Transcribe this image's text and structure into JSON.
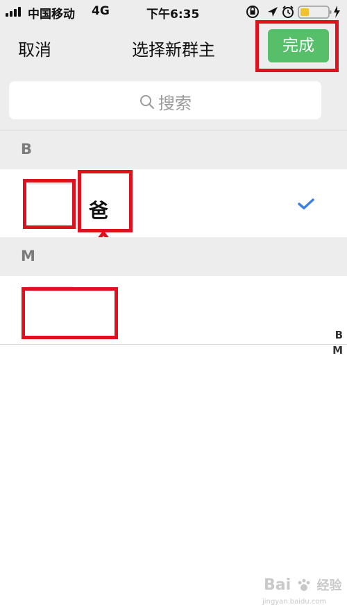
{
  "status_bar": {
    "carrier": "中国移动",
    "network": "4G",
    "time": "下午6:35"
  },
  "nav": {
    "cancel_label": "取消",
    "title": "选择新群主",
    "done_label": "完成"
  },
  "search": {
    "label": "搜索"
  },
  "sections": [
    {
      "letter": "B",
      "contacts": [
        {
          "name": "爸",
          "selected": true
        }
      ]
    },
    {
      "letter": "M",
      "contacts": [
        {
          "name": ""
        }
      ]
    }
  ],
  "index_bar": [
    "B",
    "M"
  ],
  "watermark": {
    "brand": "Bai",
    "domain": "jingyan.baidu.com",
    "suffix": "经验"
  },
  "colors": {
    "done_button": "#57be6a",
    "annotation": "#e0111f",
    "check": "#3b82e0"
  }
}
